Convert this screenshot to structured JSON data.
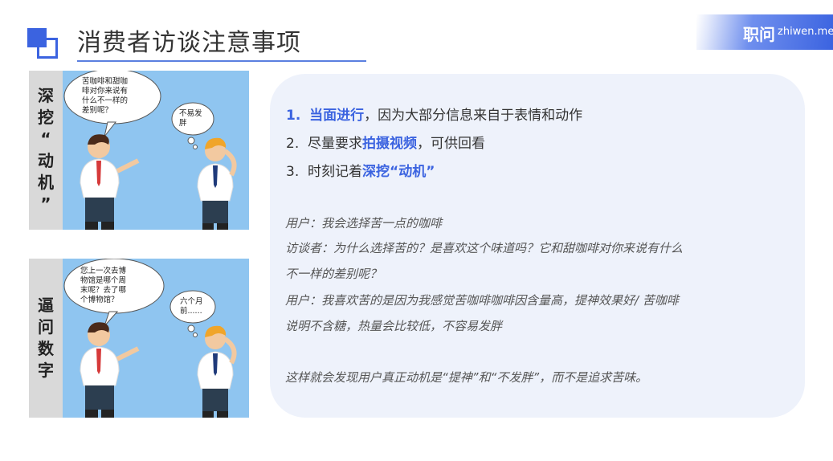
{
  "header": {
    "title": "消费者访谈注意事项",
    "accent_color": "#3b63e0",
    "logo_cn": "职问",
    "logo_en": "zhiwen.me"
  },
  "panels": [
    {
      "label": [
        "深",
        "挖",
        "“",
        "动",
        "机",
        "”"
      ],
      "bubble_left": [
        "苦咖啡和甜咖",
        "啡对你来说有",
        "什么不一样的",
        "差别呢？"
      ],
      "bubble_right": [
        "不易发",
        "胖"
      ]
    },
    {
      "label": [
        "逼",
        "问",
        "数",
        "字"
      ],
      "bubble_left": [
        "您上一次去博",
        "物馆是哪个周",
        "末呢？去了哪",
        "个博物馆？"
      ],
      "bubble_right": [
        "六个月",
        "前......"
      ]
    }
  ],
  "points": [
    {
      "num": "1.",
      "highlight": "当面进行",
      "rest": "，因为大部分信息来自于表情和动作"
    },
    {
      "num": "2.",
      "pre": "尽量要求",
      "highlight": "拍摄视频",
      "rest": "，可供回看"
    },
    {
      "num": "3.",
      "pre": "时刻记着",
      "highlight": "深挖“动机”"
    }
  ],
  "dialogue": [
    "用户：我会选择苦一点的咖啡",
    "访谈者：为什么选择苦的？是喜欢这个味道吗？它和甜咖啡对你来说有什么",
    "不一样的差别呢？",
    "用户：我喜欢苦的是因为我感觉苦咖啡咖啡因含量高，提神效果好/ 苦咖啡",
    "说明不含糖，热量会比较低，不容易发胖",
    "这样就会发现用户真正动机是“提神”和“不发胖”，而不是追求苦味。"
  ]
}
